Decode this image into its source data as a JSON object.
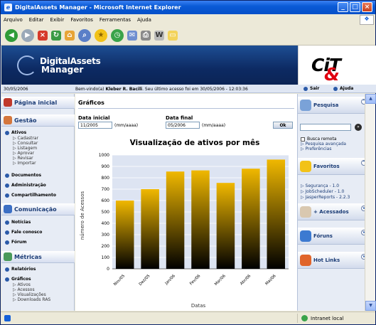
{
  "window": {
    "title": "DigitalAssets Manager - Microsoft Internet Explorer"
  },
  "menubar": {
    "items": [
      "Arquivo",
      "Editar",
      "Exibir",
      "Favoritos",
      "Ferramentas",
      "Ajuda"
    ]
  },
  "site": {
    "brand_line1": "DigitalAssets",
    "brand_line2": "Manager",
    "partner_logo": "Ci&T"
  },
  "strip": {
    "date": "30/05/2006",
    "welcome_prefix": "Bem-vindo(a)",
    "user": "Kleber R. Bacili",
    "welcome_suffix": ". Seu último acesso foi em 30/05/2006 - 12:03:36",
    "logout_label": "Sair",
    "help_label": "Ajuda"
  },
  "left": {
    "home_label": "Página inicial",
    "gestao_label": "Gestão",
    "ativos_label": "Ativos",
    "ativos_subs": [
      "Cadastrar",
      "Consultar",
      "Listagem",
      "Aprovar",
      "Revisar",
      "Importar"
    ],
    "documentos_label": "Documentos",
    "administracao_label": "Administração",
    "compartilhamento_label": "Compartilhamento",
    "comunicacao_label": "Comunicação",
    "noticias_label": "Notícias",
    "fale_label": "Fale conosco",
    "forum_label": "Fórum",
    "metricas_label": "Métricas",
    "relatorios_label": "Relatórios",
    "graficos_label": "Gráficos",
    "graficos_subs": [
      "Ativos",
      "Acessos",
      "Visualizações",
      "Downloads RAS"
    ]
  },
  "main": {
    "title": "Gráficos",
    "start_label": "Data inicial",
    "start_value": "11/2005",
    "start_hint": "(mm/aaaa)",
    "end_label": "Data final",
    "end_value": "05/2006",
    "end_hint": "(mm/aaaa)",
    "ok_label": "Ok"
  },
  "right": {
    "search_label": "Pesquisa",
    "remote_label": "Busca remota",
    "advanced_label": "Pesquisa avançada",
    "prefs_label": "Preferências",
    "favorites_label": "Favoritos",
    "favorites_items": [
      "Segurança - 1.0",
      "JobScheduler - 1.0",
      "JasperReports - 2.2.3"
    ],
    "accessed_label": "+ Acessados",
    "forums_label": "Fóruns",
    "hotlinks_label": "Hot Links"
  },
  "status": {
    "zone": "Intranet local"
  },
  "colors": {
    "bar_top": "#f0b800",
    "bar_bottom": "#000000",
    "plot_bg": "#dde4f2",
    "header_bg": "#0d2a63",
    "accent_red": "#e00010"
  },
  "chart_data": {
    "type": "bar",
    "title": "Visualização de ativos por mês",
    "xlabel": "Datas",
    "ylabel": "número de Acessos",
    "categories": [
      "Nov/05",
      "Dez/05",
      "Jan/06",
      "Fev/06",
      "Mar/06",
      "Abr/06",
      "Mai/06"
    ],
    "values": [
      600,
      700,
      855,
      865,
      755,
      880,
      960
    ],
    "ylim": [
      0,
      1000
    ],
    "yticks": [
      0,
      100,
      200,
      300,
      400,
      500,
      600,
      700,
      800,
      900,
      1000
    ],
    "grid": true
  }
}
